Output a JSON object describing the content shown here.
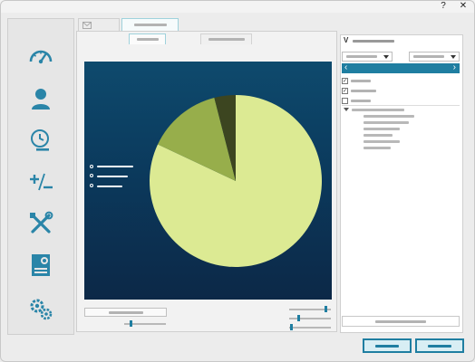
{
  "window": {
    "help_label": "?",
    "close_label": "✕"
  },
  "sidebar": {
    "items": [
      {
        "name": "dashboard",
        "icon": "gauge-icon"
      },
      {
        "name": "user",
        "icon": "user-icon"
      },
      {
        "name": "history",
        "icon": "clock-icon"
      },
      {
        "name": "calculations",
        "icon": "plus-minus-icon"
      },
      {
        "name": "tools",
        "icon": "tools-icon"
      },
      {
        "name": "reports",
        "icon": "document-icon"
      },
      {
        "name": "settings",
        "icon": "gears-icon"
      }
    ]
  },
  "colors": {
    "accent": "#1f7ea1",
    "sidebar_icon": "#2a85a8",
    "chart_bg": "#0b3a5d"
  },
  "chart_data": {
    "type": "pie",
    "values": [
      82,
      14,
      4
    ],
    "colors": [
      "#dcea93",
      "#97ae4b",
      "#3c4520"
    ]
  },
  "right_panel": {
    "arrow_left": "‹",
    "arrow_right": "›",
    "collapse_label": "V"
  }
}
